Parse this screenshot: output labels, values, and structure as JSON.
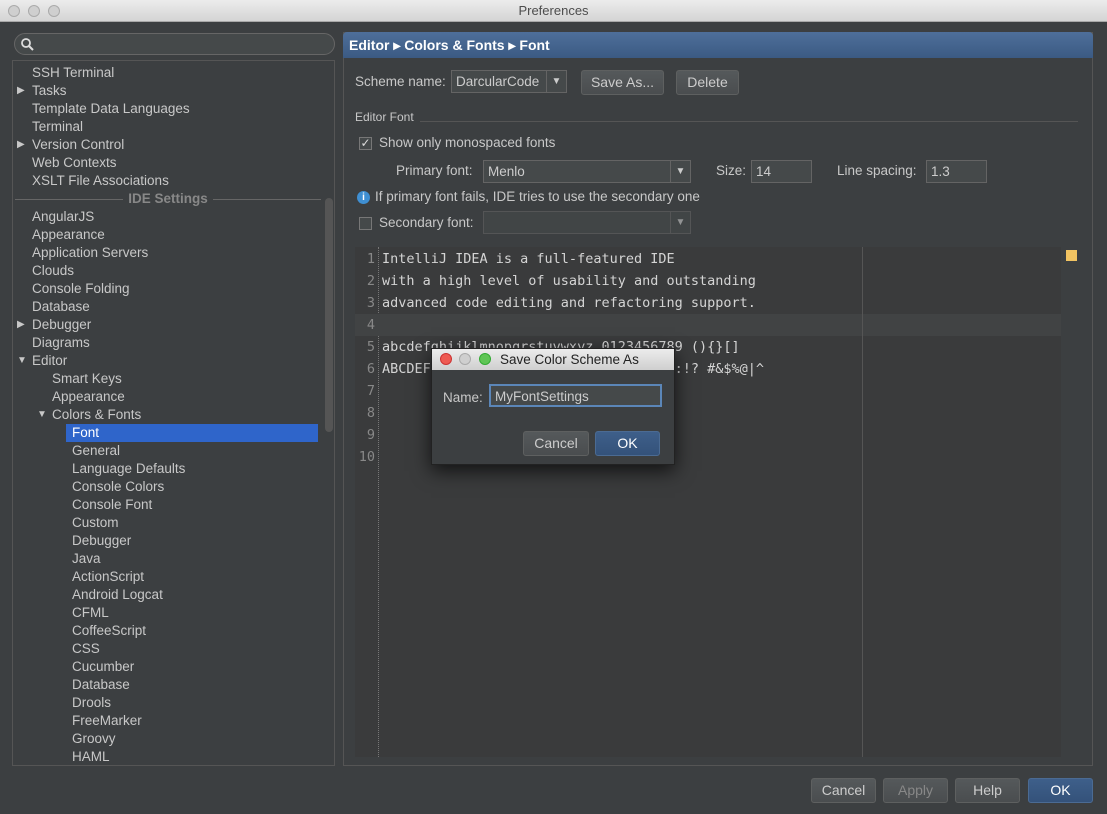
{
  "window": {
    "title": "Preferences"
  },
  "search": {
    "placeholder": ""
  },
  "tree": [
    {
      "label": "SSH Terminal",
      "level": 1,
      "arrow": ""
    },
    {
      "label": "Tasks",
      "level": 1,
      "arrow": "▶"
    },
    {
      "label": "Template Data Languages",
      "level": 1,
      "arrow": ""
    },
    {
      "label": "Terminal",
      "level": 1,
      "arrow": ""
    },
    {
      "label": "Version Control",
      "level": 1,
      "arrow": "▶"
    },
    {
      "label": "Web Contexts",
      "level": 1,
      "arrow": ""
    },
    {
      "label": "XSLT File Associations",
      "level": 1,
      "arrow": ""
    },
    {
      "label": "IDE Settings",
      "level": 0,
      "section": true
    },
    {
      "label": "AngularJS",
      "level": 1,
      "arrow": ""
    },
    {
      "label": "Appearance",
      "level": 1,
      "arrow": ""
    },
    {
      "label": "Application Servers",
      "level": 1,
      "arrow": ""
    },
    {
      "label": "Clouds",
      "level": 1,
      "arrow": ""
    },
    {
      "label": "Console Folding",
      "level": 1,
      "arrow": ""
    },
    {
      "label": "Database",
      "level": 1,
      "arrow": ""
    },
    {
      "label": "Debugger",
      "level": 1,
      "arrow": "▶"
    },
    {
      "label": "Diagrams",
      "level": 1,
      "arrow": ""
    },
    {
      "label": "Editor",
      "level": 1,
      "arrow": "▼"
    },
    {
      "label": "Smart Keys",
      "level": 2,
      "arrow": ""
    },
    {
      "label": "Appearance",
      "level": 2,
      "arrow": ""
    },
    {
      "label": "Colors & Fonts",
      "level": 2,
      "arrow": "▼"
    },
    {
      "label": "Font",
      "level": 3,
      "arrow": "",
      "selected": true
    },
    {
      "label": "General",
      "level": 3,
      "arrow": ""
    },
    {
      "label": "Language Defaults",
      "level": 3,
      "arrow": ""
    },
    {
      "label": "Console Colors",
      "level": 3,
      "arrow": ""
    },
    {
      "label": "Console Font",
      "level": 3,
      "arrow": ""
    },
    {
      "label": "Custom",
      "level": 3,
      "arrow": ""
    },
    {
      "label": "Debugger",
      "level": 3,
      "arrow": ""
    },
    {
      "label": "Java",
      "level": 3,
      "arrow": ""
    },
    {
      "label": "ActionScript",
      "level": 3,
      "arrow": ""
    },
    {
      "label": "Android Logcat",
      "level": 3,
      "arrow": ""
    },
    {
      "label": "CFML",
      "level": 3,
      "arrow": ""
    },
    {
      "label": "CoffeeScript",
      "level": 3,
      "arrow": ""
    },
    {
      "label": "CSS",
      "level": 3,
      "arrow": ""
    },
    {
      "label": "Cucumber",
      "level": 3,
      "arrow": ""
    },
    {
      "label": "Database",
      "level": 3,
      "arrow": ""
    },
    {
      "label": "Drools",
      "level": 3,
      "arrow": ""
    },
    {
      "label": "FreeMarker",
      "level": 3,
      "arrow": ""
    },
    {
      "label": "Groovy",
      "level": 3,
      "arrow": ""
    },
    {
      "label": "HAML",
      "level": 3,
      "arrow": ""
    }
  ],
  "header": {
    "breadcrumb": "Editor ▸ Colors & Fonts ▸ Font"
  },
  "scheme": {
    "label": "Scheme name:",
    "value": "DarcularCode",
    "save_as": "Save As...",
    "delete": "Delete"
  },
  "font": {
    "section": "Editor Font",
    "mono_label": "Show only monospaced fonts",
    "mono_checked": true,
    "primary_label": "Primary font:",
    "primary_value": "Menlo",
    "size_label": "Size:",
    "size_value": "14",
    "spacing_label": "Line spacing:",
    "spacing_value": "1.3",
    "info": "If primary font fails, IDE tries to use the secondary one",
    "secondary_label": "Secondary font:",
    "secondary_checked": false,
    "secondary_value": ""
  },
  "preview": {
    "lines": [
      "IntelliJ IDEA is a full-featured IDE",
      "with a high level of usability and outstanding",
      "advanced code editing and refactoring support.",
      "",
      "abcdefghijklmnopqrstuvwxyz 0123456789 (){}[]",
      "ABCDEFGHIJKLMNOPQRSTUVWXYZ +-*/= .,;:!? #&$%@|^",
      "",
      "",
      "",
      ""
    ],
    "line_numbers": [
      "1",
      "2",
      "3",
      "4",
      "5",
      "6",
      "7",
      "8",
      "9",
      "10"
    ]
  },
  "dialog": {
    "title": "Save Color Scheme As",
    "name_label": "Name:",
    "name_value": "MyFontSettings",
    "cancel": "Cancel",
    "ok": "OK"
  },
  "footer": {
    "cancel": "Cancel",
    "apply": "Apply",
    "help": "Help",
    "ok": "OK"
  },
  "colors": {
    "selection": "#2f65ca",
    "header": "#3d5c86",
    "background": "#3c3f41"
  }
}
